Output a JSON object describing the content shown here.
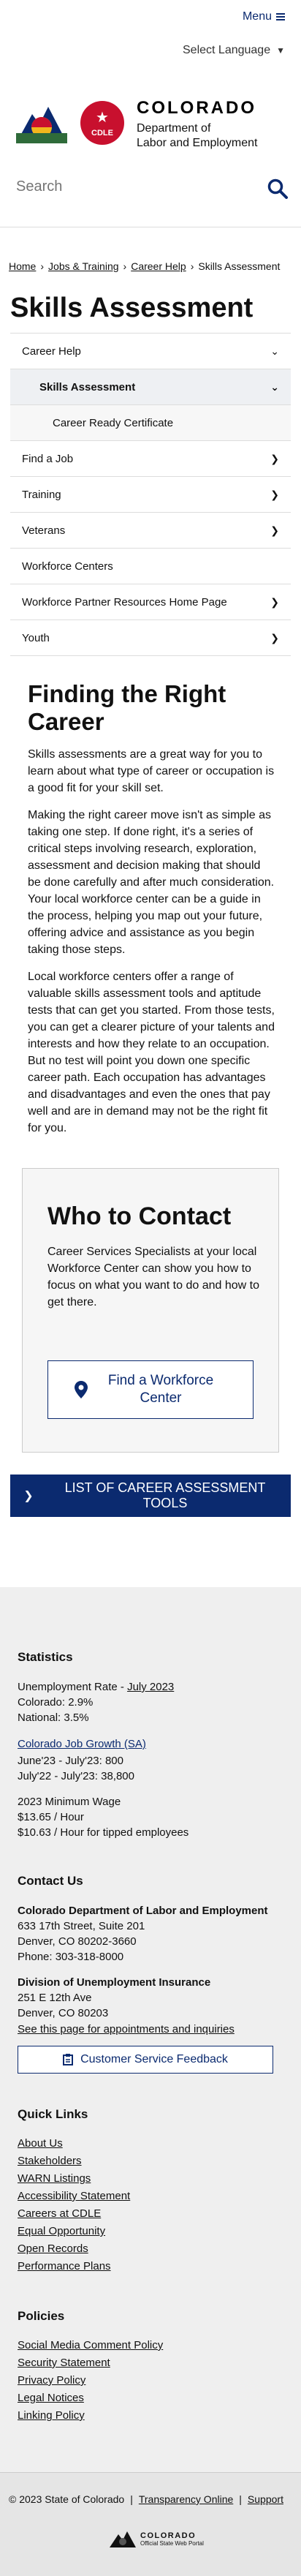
{
  "header": {
    "menu_label": "Menu",
    "language_label": "Select Language",
    "logo_title": "COLORADO",
    "logo_subtitle_1": "Department of",
    "logo_subtitle_2": "Labor and Employment",
    "cdle_badge": "CDLE",
    "search_placeholder": "Search"
  },
  "breadcrumb": [
    "Home",
    "Jobs & Training",
    "Career Help",
    "Skills Assessment"
  ],
  "page_title": "Skills Assessment",
  "sidenav": [
    {
      "label": "Career Help",
      "chevron": "down",
      "level": 0
    },
    {
      "label": "Skills Assessment",
      "chevron": "down",
      "level": 1,
      "active": true
    },
    {
      "label": "Career Ready Certificate",
      "chevron": "",
      "level": 2
    },
    {
      "label": "Find a Job",
      "chevron": "right",
      "level": 0
    },
    {
      "label": "Training",
      "chevron": "right",
      "level": 0
    },
    {
      "label": "Veterans",
      "chevron": "right",
      "level": 0
    },
    {
      "label": "Workforce Centers",
      "chevron": "",
      "level": 0
    },
    {
      "label": "Workforce Partner Resources Home Page",
      "chevron": "right",
      "level": 0
    },
    {
      "label": "Youth",
      "chevron": "right",
      "level": 0
    }
  ],
  "main": {
    "heading": "Finding the Right Career",
    "paragraphs": [
      "Skills assessments are a great way for you to learn about what type of career or occupation is a good fit for your skill set.",
      "Making the right career move isn't as simple as taking one step. If done right, it's a series of critical steps involving research, exploration, assessment and decision making that should be done carefully and after much consideration. Your local workforce center can be a guide in the process, helping you map out your future, offering advice and assistance as you begin taking those steps.",
      "Local workforce centers offer a range of valuable skills assessment tools and aptitude tests that can get you started. From those tests, you can get a clearer picture of your talents and interests and how they relate to an occupation. But no test will point you down one specific career path. Each occupation has advantages and disadvantages and even the ones that pay well and are in demand may not be the right fit for you."
    ]
  },
  "contact": {
    "title": "Who to Contact",
    "text": "Career Services Specialists at your local Workforce Center can show you how to focus on what you want to do and how to get there.",
    "button_label": "Find a Workforce Center"
  },
  "list_button": "LIST OF CAREER ASSESSMENT TOOLS",
  "footer": {
    "statistics_title": "Statistics",
    "unemployment_label": "Unemployment Rate - ",
    "unemployment_link": "July 2023",
    "colorado_rate": "Colorado: 2.9%",
    "national_rate": "National: 3.5%",
    "job_growth_link": "Colorado Job Growth (SA)",
    "job_growth_1": "June'23 - July'23: 800",
    "job_growth_2": "July'22 - July'23: 38,800",
    "min_wage_title": "2023 Minimum Wage",
    "min_wage_1": "$13.65 / Hour",
    "min_wage_2": "$10.63 / Hour for tipped employees",
    "contact_title": "Contact Us",
    "dept_name": "Colorado Department of Labor and Employment",
    "dept_addr_1": "633 17th Street, Suite 201",
    "dept_addr_2": "Denver, CO  80202-3660",
    "dept_phone": "Phone: 303-318-8000",
    "div_name": "Division of Unemployment Insurance",
    "div_addr_1": "251 E 12th Ave",
    "div_addr_2": "Denver, CO  80203",
    "appointments_link": "See this page for appointments and inquiries",
    "feedback_button": "Customer Service Feedback",
    "quick_links_title": "Quick Links",
    "quick_links": [
      "About Us",
      "Stakeholders",
      "WARN Listings",
      "Accessibility Statement",
      "Careers at CDLE",
      "Equal Opportunity",
      "Open Records",
      "Performance Plans"
    ],
    "policies_title": "Policies",
    "policies": [
      "Social Media Comment Policy",
      "Security Statement",
      "Privacy Policy",
      "Legal Notices",
      "Linking Policy"
    ],
    "copyright": "© 2023 State of Colorado",
    "transparency_link": "Transparency Online",
    "support_link": "Support",
    "portal_title": "COLORADO",
    "portal_subtitle": "Official State Web Portal"
  },
  "colors": {
    "brand_blue": "#0b2a6f",
    "cdle_red": "#c8102e",
    "footer_bg": "#efefef"
  }
}
